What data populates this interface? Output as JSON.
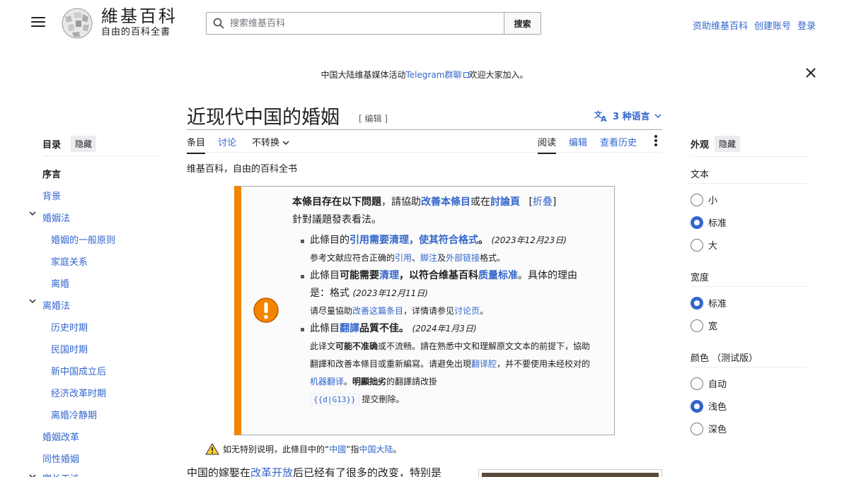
{
  "header": {
    "wordmark_title": "維基百科",
    "wordmark_tagline": "自由的百科全書",
    "search_placeholder": "搜索维基百科",
    "search_button": "搜索",
    "user_links": [
      "资助维基百科",
      "创建账号",
      "登录"
    ]
  },
  "banner": {
    "prefix": "中国大陆维基媒体活动",
    "link": "Telegram群聊",
    "suffix": "欢迎大家加入。"
  },
  "page": {
    "title": "近现代中国的婚姻",
    "title_edit": "[ 编辑 ]",
    "languages": "3 种语言",
    "tabs_left": [
      "条目",
      "讨论",
      "不转换"
    ],
    "tabs_right": [
      "阅读",
      "编辑",
      "查看历史"
    ],
    "sitesub": "维基百科，自由的百科全书"
  },
  "ambox": {
    "intro_bold": "本條目存在以下問題",
    "intro_mid": "，請協助",
    "intro_link1": "改善本條目",
    "intro_or": "或在",
    "intro_link2": "討論頁",
    "intro_fold": "折叠",
    "intro_end": "針對議題發表看法。",
    "issue1_pre": "此條目的",
    "issue1_link": "引用需要清理，使其符合格式",
    "issue1_dot": "。",
    "issue1_date": "(2023年12月23日)",
    "issue1_sub_pre": "参考文献应符合正确的",
    "issue1_sub_l1": "引用",
    "issue1_sub_sep": "、",
    "issue1_sub_l2": "脚注",
    "issue1_sub_and": "及",
    "issue1_sub_l3": "外部链接",
    "issue1_sub_end": "格式。",
    "issue2_pre": "此條目",
    "issue2_bold": "可能需要",
    "issue2_link": "清理",
    "issue2_mid": "，以符合维基百科",
    "issue2_link2": "质量标准",
    "issue2_end": "。具体的理由是：格式",
    "issue2_date": "(2023年12月11日)",
    "issue2_sub_pre": "请尽量協助",
    "issue2_sub_link": "改善这篇条目",
    "issue2_sub_mid": "，详情请参见",
    "issue2_sub_link2": "讨论页",
    "issue2_sub_end": "。",
    "issue3_pre": "此條目",
    "issue3_link": "翻譯",
    "issue3_bold": "品質不佳。",
    "issue3_date": "(2024年1月3日)",
    "issue3_sub_a": "此译文",
    "issue3_sub_bold": "可能不准确",
    "issue3_sub_b": "或不流畅。請在熟悉中文和理解原文文本的前提下，協助翻譯和改善本條目或重新編寫。请避免出現",
    "issue3_sub_link": "翻译腔",
    "issue3_sub_c": "，并不要使用未经校对的",
    "issue3_sub_link2": "机器翻译",
    "issue3_sub_d": "。",
    "issue3_sub_bold2": "明顯拙劣",
    "issue3_sub_e": "的翻譯請改掛",
    "issue3_code": "{{d|G13}}",
    "issue3_sub_f": "提交刪除。"
  },
  "note": {
    "pre": "如无特别说明，此條目中的“",
    "link1": "中國",
    "mid": "”指",
    "link2": "中国大陆",
    "end": "。"
  },
  "body": {
    "pre": "中国的嫁娶在",
    "link": "改革开放",
    "post": "后已经有了很多的改变，特别是"
  },
  "toc": {
    "title": "目录",
    "hide": "隐藏",
    "items": [
      "序言",
      "背景",
      "婚姻法",
      "婚姻的一般原则",
      "家庭关系",
      "离婚",
      "离婚法",
      "历史时期",
      "民国时期",
      "新中国成立后",
      "经济改革时期",
      "离婚冷静期",
      "婚姻改革",
      "同性婚姻",
      "家长干涉"
    ]
  },
  "appearance": {
    "title": "外观",
    "hide": "隐藏",
    "text_label": "文本",
    "text_options": [
      "小",
      "标准",
      "大"
    ],
    "text_selected": "标准",
    "width_label": "宽度",
    "width_options": [
      "标准",
      "宽"
    ],
    "width_selected": "标准",
    "color_label": "颜色 （测试版）",
    "color_options": [
      "自动",
      "浅色",
      "深色"
    ],
    "color_selected": "浅色"
  },
  "colors": {
    "link": "#3366cc",
    "accent_orange": "#f28500",
    "text": "#202122"
  }
}
